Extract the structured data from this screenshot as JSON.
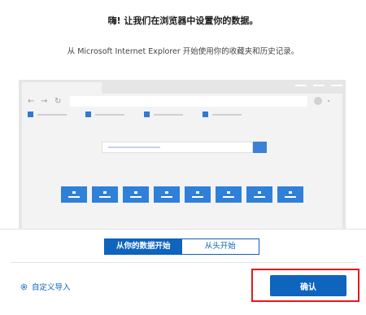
{
  "header": {
    "title": "嗨! 让我们在浏览器中设置你的数据。",
    "subtitle": "从 Microsoft Internet Explorer 开始使用你的收藏夹和历史记录。"
  },
  "illustration": {
    "nav_icons": [
      "←",
      "→",
      "↻"
    ],
    "favorites_count": 4,
    "tile_count": 8,
    "colors": {
      "accent": "#2e80d9",
      "frame": "#e6e6e6"
    }
  },
  "toggle": {
    "options": [
      "从你的数据开始",
      "从头开始"
    ],
    "selected": "从你的数据开始"
  },
  "footer": {
    "custom_import_label": "自定义导入",
    "custom_import_icon": "gear-icon",
    "confirm_label": "确认",
    "highlight_color": "#e5181e",
    "accent_color": "#0f64bd"
  }
}
